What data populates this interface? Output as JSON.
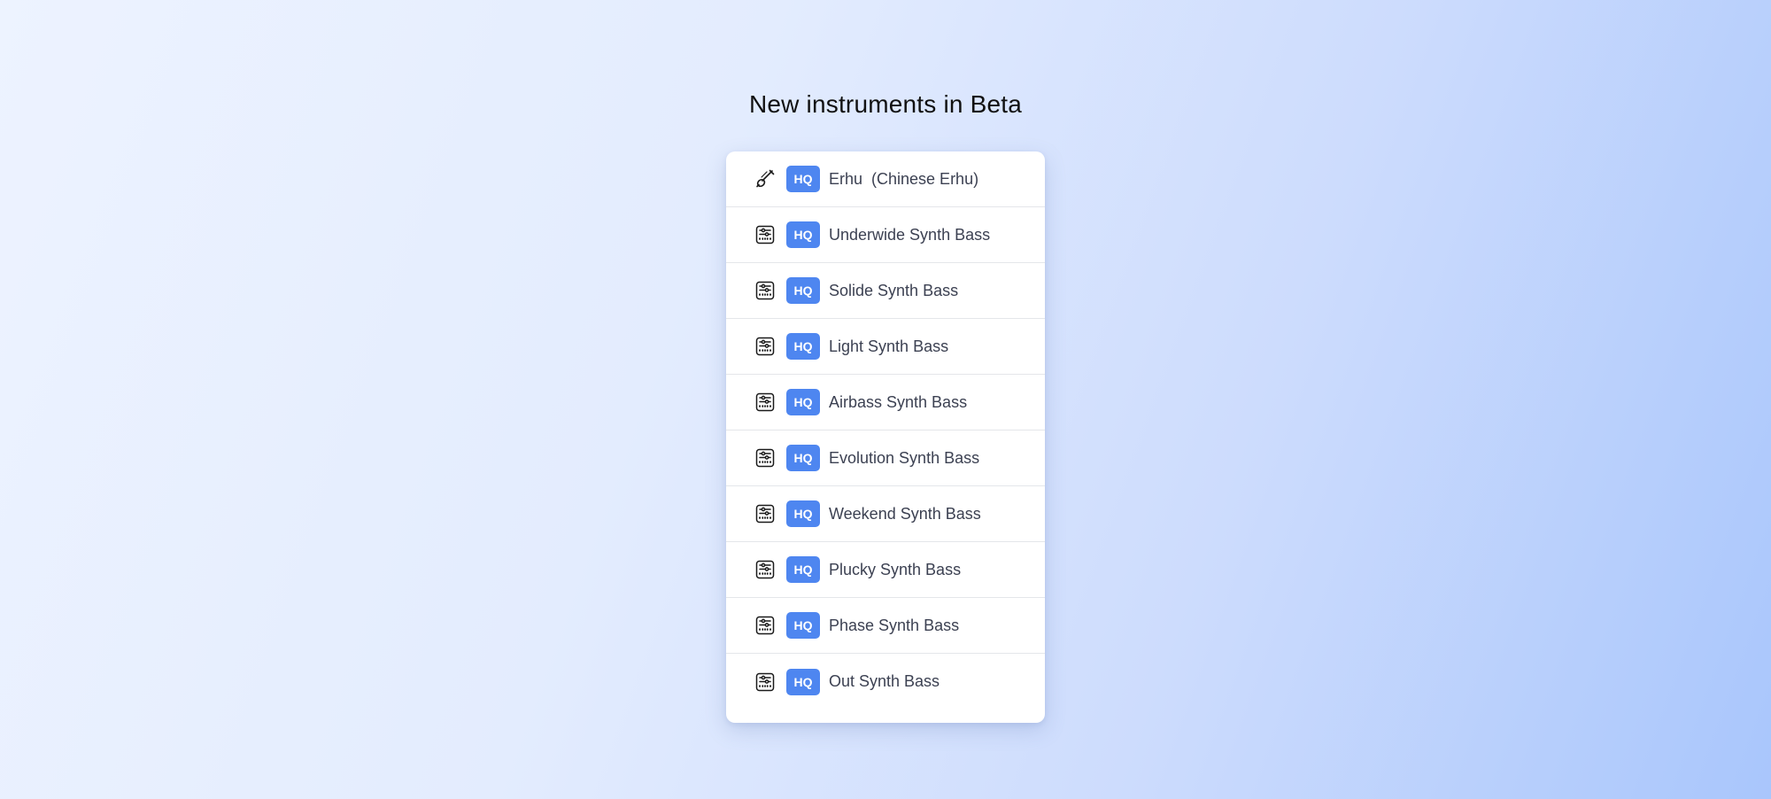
{
  "page": {
    "title": "New instruments in Beta"
  },
  "colors": {
    "badge_bg": "#4e86f0",
    "badge_text": "#ffffff",
    "item_text": "#3c4152",
    "divider": "#e4e6ea"
  },
  "instruments": [
    {
      "icon": "erhu-icon",
      "badge": "HQ",
      "name": "Erhu  (Chinese Erhu)"
    },
    {
      "icon": "synth-icon",
      "badge": "HQ",
      "name": "Underwide Synth Bass"
    },
    {
      "icon": "synth-icon",
      "badge": "HQ",
      "name": "Solide Synth Bass"
    },
    {
      "icon": "synth-icon",
      "badge": "HQ",
      "name": "Light Synth Bass"
    },
    {
      "icon": "synth-icon",
      "badge": "HQ",
      "name": "Airbass Synth Bass"
    },
    {
      "icon": "synth-icon",
      "badge": "HQ",
      "name": "Evolution Synth Bass"
    },
    {
      "icon": "synth-icon",
      "badge": "HQ",
      "name": "Weekend Synth Bass"
    },
    {
      "icon": "synth-icon",
      "badge": "HQ",
      "name": "Plucky Synth Bass"
    },
    {
      "icon": "synth-icon",
      "badge": "HQ",
      "name": "Phase Synth Bass"
    },
    {
      "icon": "synth-icon",
      "badge": "HQ",
      "name": "Out Synth Bass"
    }
  ]
}
